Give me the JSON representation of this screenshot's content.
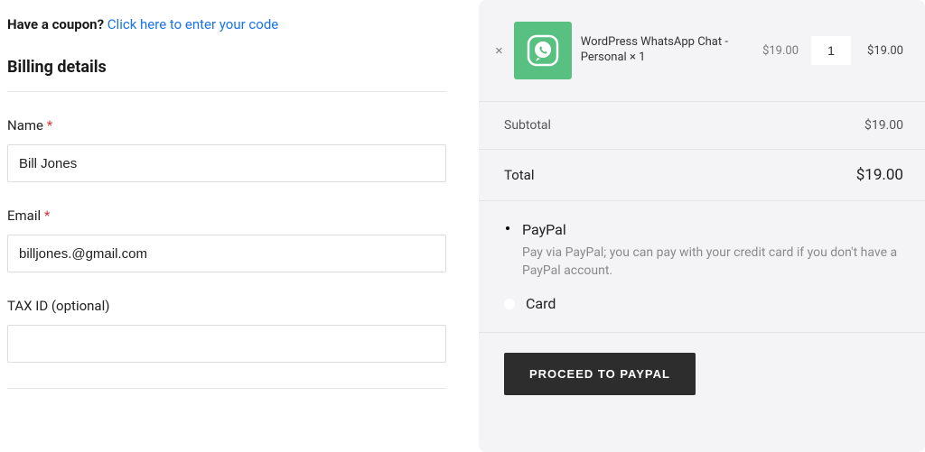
{
  "coupon": {
    "prompt": "Have a coupon?",
    "link": "Click here to enter your code"
  },
  "billing": {
    "heading": "Billing details",
    "fields": {
      "name": {
        "label": "Name",
        "value": "Bill Jones",
        "required": "*"
      },
      "email": {
        "label": "Email",
        "value": "billjones.@gmail.com",
        "required": "*"
      },
      "tax_id": {
        "label": "TAX ID (optional)",
        "value": ""
      }
    }
  },
  "cart": {
    "remove_symbol": "×",
    "product_name": "WordPress WhatsApp Chat - Personal × 1",
    "unit_price": "$19.00",
    "quantity": "1",
    "line_total": "$19.00",
    "icon_name": "whatsapp-icon"
  },
  "summary": {
    "subtotal_label": "Subtotal",
    "subtotal_value": "$19.00",
    "total_label": "Total",
    "total_value": "$19.00"
  },
  "payment": {
    "paypal": {
      "title": "PayPal",
      "desc": "Pay via PayPal; you can pay with your credit card if you don't have a PayPal account."
    },
    "card": {
      "title": "Card"
    }
  },
  "checkout": {
    "button": "PROCEED TO PAYPAL"
  }
}
